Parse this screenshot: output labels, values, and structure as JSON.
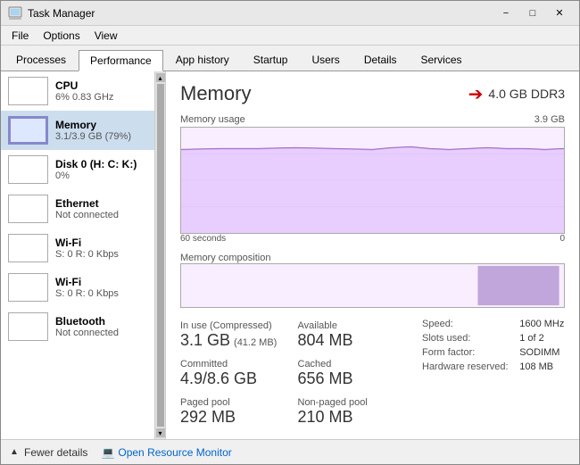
{
  "window": {
    "title": "Task Manager"
  },
  "menu": {
    "items": [
      "File",
      "Options",
      "View"
    ]
  },
  "tabs": [
    {
      "label": "Processes",
      "active": false
    },
    {
      "label": "Performance",
      "active": true
    },
    {
      "label": "App history",
      "active": false
    },
    {
      "label": "Startup",
      "active": false
    },
    {
      "label": "Users",
      "active": false
    },
    {
      "label": "Details",
      "active": false
    },
    {
      "label": "Services",
      "active": false
    }
  ],
  "sidebar": {
    "items": [
      {
        "name": "CPU",
        "sub": "6%  0.83 GHz",
        "type": "cpu",
        "selected": false
      },
      {
        "name": "Memory",
        "sub": "3.1/3.9 GB (79%)",
        "type": "memory",
        "selected": true
      },
      {
        "name": "Disk 0 (H: C: K:)",
        "sub": "0%",
        "type": "disk",
        "selected": false
      },
      {
        "name": "Ethernet",
        "sub": "Not connected",
        "type": "ethernet",
        "selected": false
      },
      {
        "name": "Wi-Fi",
        "sub": "S: 0  R: 0 Kbps",
        "type": "wifi1",
        "selected": false
      },
      {
        "name": "Wi-Fi",
        "sub": "S: 0  R: 0 Kbps",
        "type": "wifi2",
        "selected": false
      },
      {
        "name": "Bluetooth",
        "sub": "Not connected",
        "type": "bluetooth",
        "selected": false
      }
    ]
  },
  "main": {
    "title": "Memory",
    "type_label": "4.0 GB DDR3",
    "usage_chart": {
      "top_label": "Memory usage",
      "right_label": "3.9 GB",
      "bottom_left": "60 seconds",
      "bottom_right": "0"
    },
    "comp_chart": {
      "label": "Memory composition"
    },
    "stats": {
      "in_use_label": "In use (Compressed)",
      "in_use_value": "3.1 GB",
      "in_use_sub": "(41.2 MB)",
      "available_label": "Available",
      "available_value": "804 MB",
      "committed_label": "Committed",
      "committed_value": "4.9/8.6 GB",
      "cached_label": "Cached",
      "cached_value": "656 MB",
      "paged_label": "Paged pool",
      "paged_value": "292 MB",
      "nonpaged_label": "Non-paged pool",
      "nonpaged_value": "210 MB"
    },
    "right_stats": {
      "speed_label": "Speed:",
      "speed_value": "1600 MHz",
      "slots_label": "Slots used:",
      "slots_value": "1 of 2",
      "form_label": "Form factor:",
      "form_value": "SODIMM",
      "hw_label": "Hardware reserved:",
      "hw_value": "108 MB"
    }
  },
  "bottom": {
    "fewer_details": "Fewer details",
    "open_monitor": "Open Resource Monitor"
  }
}
